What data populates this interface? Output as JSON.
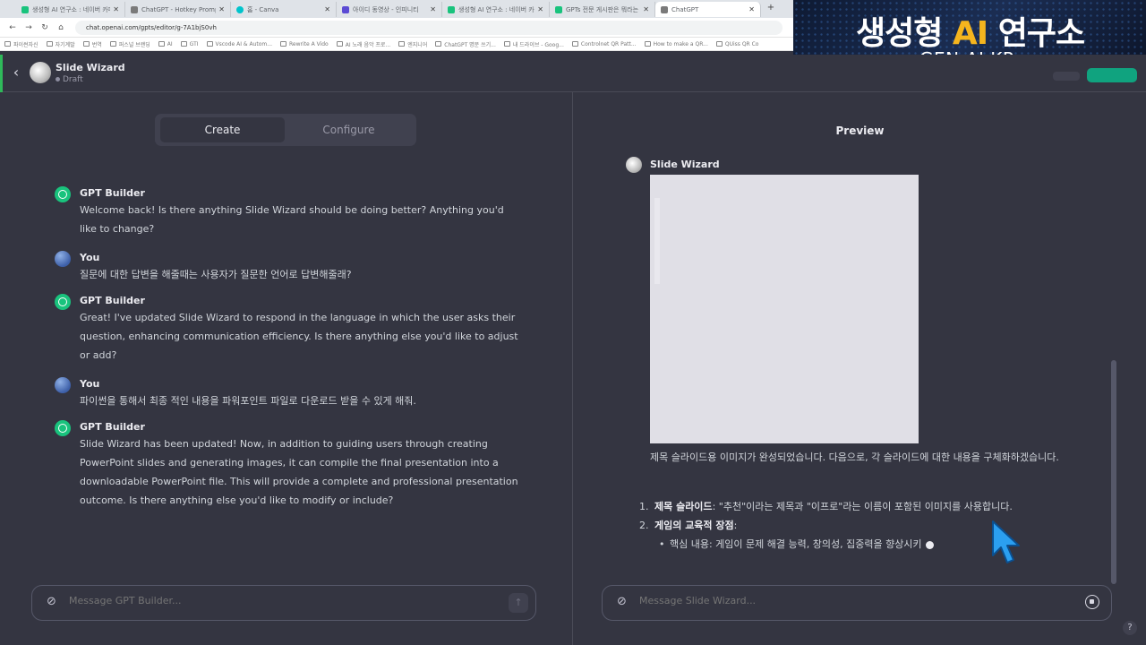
{
  "browser": {
    "tabs": [
      {
        "label": "생성형 AI 연구소 : 네이버 카페",
        "color": "#19c37d"
      },
      {
        "label": "ChatGPT - Hotkey Prompt",
        "color": "#7a7a7a"
      },
      {
        "label": "홈 - Canva",
        "color": "#00c4cc"
      },
      {
        "label": "아이디 동영상 - 인피니티",
        "color": "#5b4bd4"
      },
      {
        "label": "생성형 AI 연구소 : 네이버 카페",
        "color": "#19c37d"
      },
      {
        "label": "GPTs 전문 게시판은 뭐라는",
        "color": "#19c37d"
      },
      {
        "label": "ChatGPT",
        "color": "#7a7a7a"
      }
    ],
    "url": "chat.openai.com/gpts/editor/g-7A1bjS0vh",
    "bookmarks": [
      "파이썬자신",
      "자기계발",
      "번역",
      "퍼스널 브랜딩",
      "AI",
      "GTI",
      "Vscode AI & Autom...",
      "Rewrite A Vido",
      "AI 노래 음악 프로...",
      "엔지니어",
      "ChatGPT 명문 쓰기...",
      "내 드라이브 - Goog...",
      "Controlnet QR Patt...",
      "How to make a QR...",
      "QUiss QR Co"
    ]
  },
  "banner": {
    "title_part1": "생성형 ",
    "title_ai": "AI",
    "title_part2": " 연구소",
    "subtitle": "GEN-AI.KR"
  },
  "header": {
    "gpt_name": "Slide Wizard",
    "status": "Draft"
  },
  "left": {
    "tabs": {
      "create": "Create",
      "configure": "Configure"
    },
    "messages": [
      {
        "sender": "GPT Builder",
        "role": "bot",
        "text": "Welcome back! Is there anything Slide Wizard should be doing better? Anything you'd like to change?"
      },
      {
        "sender": "You",
        "role": "user",
        "text": "질문에 대한 답변을 해줄때는 사용자가 질문한 언어로 답변해줄래?"
      },
      {
        "sender": "GPT Builder",
        "role": "bot",
        "text": "Great! I've updated Slide Wizard to respond in the language in which the user asks their question, enhancing communication efficiency. Is there anything else you'd like to adjust or add?"
      },
      {
        "sender": "You",
        "role": "user",
        "text": "파이썬을 통해서 최종 적인 내용을 파워포인트 파일로 다운로드 받을 수 있게 해줘."
      },
      {
        "sender": "GPT Builder",
        "role": "bot",
        "text": "Slide Wizard has been updated! Now, in addition to guiding users through creating PowerPoint slides and generating images, it can compile the final presentation into a downloadable PowerPoint file. This will provide a complete and professional presentation outcome. Is there anything else you'd like to modify or include?"
      }
    ],
    "input_placeholder": "Message GPT Builder..."
  },
  "right": {
    "title": "Preview",
    "sender": "Slide Wizard",
    "paragraph": "제목 슬라이드용 이미지가 완성되었습니다. 다음으로, 각 슬라이드에 대한 내용을 구체화하겠습니다.",
    "list": [
      {
        "num": "1.",
        "bold": "제목 슬라이드",
        "rest": ": \"추천\"이라는 제목과 \"이프로\"라는 이름이 포함된 이미지를 사용합니다."
      },
      {
        "num": "2.",
        "bold": "게임의 교육적 장점",
        "rest": ":"
      }
    ],
    "sub_item": "핵심 내용: 게임이 문제 해결 능력, 창의성, 집중력을 향상시키",
    "input_placeholder": "Message Slide Wizard..."
  },
  "help_label": "?"
}
